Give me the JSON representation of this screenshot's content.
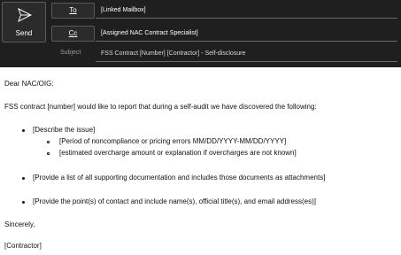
{
  "compose": {
    "send_label": "Send",
    "to_label": "To",
    "cc_label": "Cc",
    "subject_label": "Subject",
    "to_value": "[Linked Mailbox]",
    "cc_value": "[Assigned NAC Contract Specialist]",
    "subject_value": "FSS Contract [Number] [Contractor] - Self-disclosure"
  },
  "message": {
    "greeting": "Dear NAC/OIG:",
    "intro": "FSS contract [number] would like to report that during a self-audit we have discovered the following:",
    "bullet_1": "[Describe the issue]",
    "sub_1": "[Period of noncompliance or pricing errors MM/DD/YYYY-MM/DD/YYYY]",
    "sub_2": "[estimated overcharge amount or explanation if overcharges are not known]",
    "bullet_2": "[Provide a list of all supporting documentation and includes those documents as attachments]",
    "bullet_3": "[Provide the point(s) of contact and include name(s), official title(s), and email address(es)]",
    "closing": "Sincerely,",
    "signature": "[Contractor]"
  },
  "icons": {
    "send": "send-paper-plane-icon"
  },
  "colors": {
    "header_bg": "#1f1f1f",
    "button_bg": "#2b2b2b",
    "text_light": "#ffffff",
    "body_bg": "#ffffff"
  }
}
